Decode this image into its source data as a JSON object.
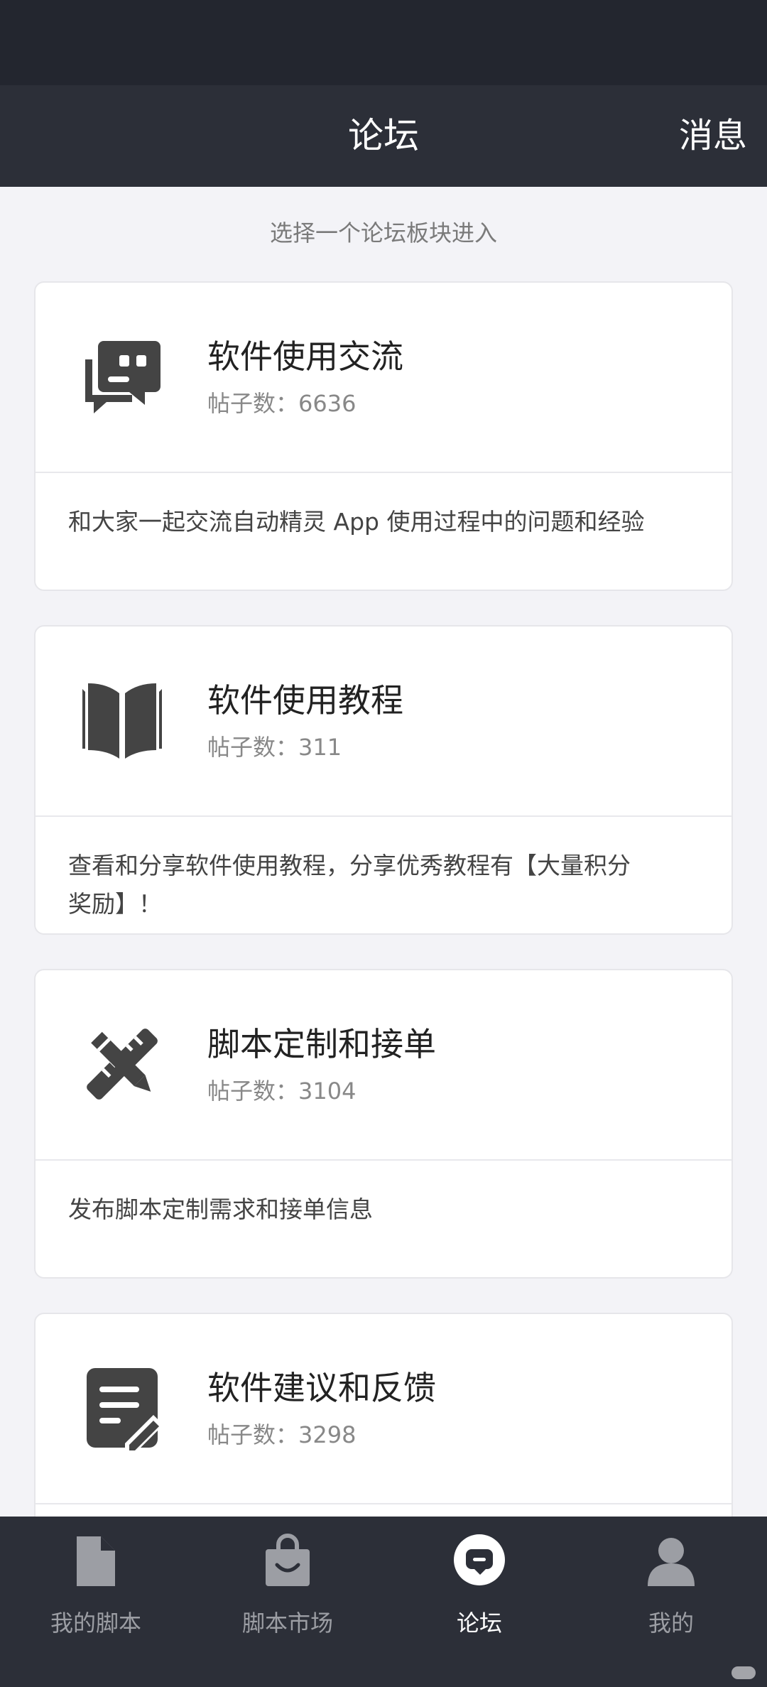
{
  "header": {
    "title": "论坛",
    "message_label": "消息"
  },
  "subtitle": "选择一个论坛板块进入",
  "boards": [
    {
      "name": "软件使用交流",
      "count_text": "帖子数：6636",
      "description": "和大家一起交流自动精灵 App 使用过程中的问题和经验",
      "icon": "chat-bubbles-icon"
    },
    {
      "name": "软件使用教程",
      "count_text": "帖子数：311",
      "description": "查看和分享软件使用教程，分享优秀教程有【大量积分奖励】！",
      "icon": "open-book-icon"
    },
    {
      "name": "脚本定制和接单",
      "count_text": "帖子数：3104",
      "description": "发布脚本定制需求和接单信息",
      "icon": "pencil-ruler-icon"
    },
    {
      "name": "软件建议和反馈",
      "count_text": "帖子数：3298",
      "description": "",
      "icon": "document-edit-icon"
    }
  ],
  "tabs": [
    {
      "label": "我的脚本",
      "icon": "file-icon",
      "active": false
    },
    {
      "label": "脚本市场",
      "icon": "shopping-bag-icon",
      "active": false
    },
    {
      "label": "论坛",
      "icon": "chat-bubble-icon",
      "active": true
    },
    {
      "label": "我的",
      "icon": "person-icon",
      "active": false
    }
  ],
  "colors": {
    "status_bar": "#23262f",
    "header": "#2c2f38",
    "background": "#f3f3f7",
    "icon_dark": "#444444",
    "tab_inactive": "#9c9ea4",
    "tab_active": "#ffffff"
  }
}
